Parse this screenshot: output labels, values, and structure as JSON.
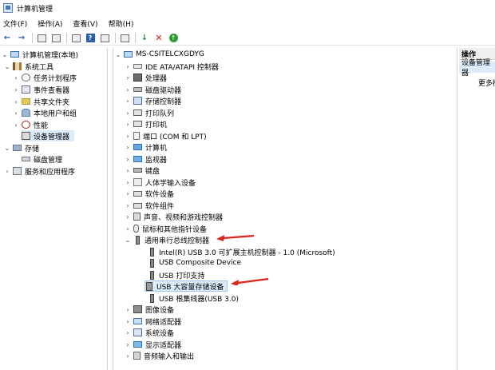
{
  "window": {
    "title": "计算机管理"
  },
  "menubar": {
    "items": [
      "文件(F)",
      "操作(A)",
      "查看(V)",
      "帮助(H)"
    ]
  },
  "left_tree": {
    "root": "计算机管理(本地)",
    "system_tools": "系统工具",
    "task_scheduler": "任务计划程序",
    "event_viewer": "事件查看器",
    "shared_folders": "共享文件夹",
    "local_users": "本地用户和组",
    "performance": "性能",
    "device_manager": "设备管理器",
    "storage": "存储",
    "disk_management": "磁盘管理",
    "services": "服务和应用程序"
  },
  "device_tree": {
    "computer": "MS-CSITELCXGDYG",
    "categories": [
      "IDE ATA/ATAPI 控制器",
      "处理器",
      "磁盘驱动器",
      "存储控制器",
      "打印队列",
      "打印机",
      "端口 (COM 和 LPT)",
      "计算机",
      "监视器",
      "键盘",
      "人体学输入设备",
      "软件设备",
      "软件组件",
      "声音、视频和游戏控制器",
      "鼠标和其他指针设备",
      "通用串行总线控制器"
    ],
    "usb_children": [
      "Intel(R) USB 3.0 可扩展主机控制器 - 1.0 (Microsoft)",
      "USB Composite Device",
      "USB 打印支持",
      "USB 大容量存储设备",
      "USB 根集线器(USB 3.0)"
    ],
    "after_categories": [
      "图像设备",
      "网络适配器",
      "系统设备",
      "显示适配器",
      "音频输入和输出"
    ]
  },
  "actions": {
    "header": "操作",
    "item1": "设备管理器",
    "item2": "更多操作"
  },
  "colors": {
    "selection": "#dcebfa",
    "annotation_arrow": "#e0211c"
  },
  "icons": {
    "back": "←",
    "forward": "→",
    "help": "?",
    "delete": "✕",
    "install": "↓",
    "update": "↑",
    "expand": "›",
    "collapse": "⌄"
  }
}
